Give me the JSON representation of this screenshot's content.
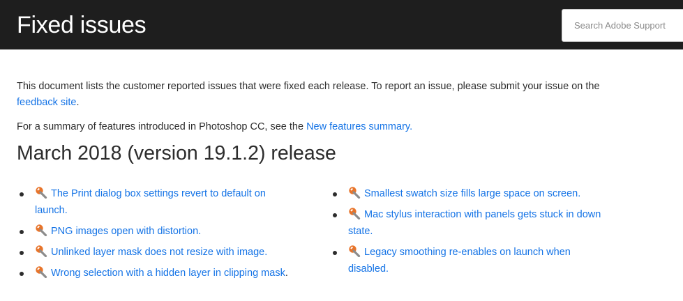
{
  "header": {
    "title": "Fixed issues",
    "search": {
      "placeholder": "Search Adobe Support",
      "value": ""
    }
  },
  "intro": {
    "text_before": "This document lists the customer reported issues that were fixed each release. To report an issue, please submit your issue on the ",
    "link_text": "feedback site",
    "text_after": "."
  },
  "summary": {
    "text_before": "For a summary of features introduced in Photoshop CC, see the ",
    "link_text": "New features summary."
  },
  "release": {
    "heading": "March 2018 (version 19.1.2) release",
    "icon": "wrench-icon",
    "left_issues": [
      {
        "label": "The Print dialog box settings revert to default on launch."
      },
      {
        "label": "PNG images open with distortion."
      },
      {
        "label": "Unlinked layer mask does not resize with image."
      },
      {
        "label": "Wrong selection with a hidden layer in clipping mask",
        "trailing": "."
      }
    ],
    "right_issues": [
      {
        "label": "Smallest swatch size fills large space on screen."
      },
      {
        "label": "Mac stylus interaction with panels gets stuck in down state."
      },
      {
        "label": "Legacy smoothing re-enables on launch when disabled."
      }
    ]
  },
  "colors": {
    "header_bg": "#1e1e1e",
    "link": "#1473e6",
    "text": "#2c2c2c",
    "icon_orange": "#e8742a",
    "icon_gray": "#8c8c8c"
  }
}
